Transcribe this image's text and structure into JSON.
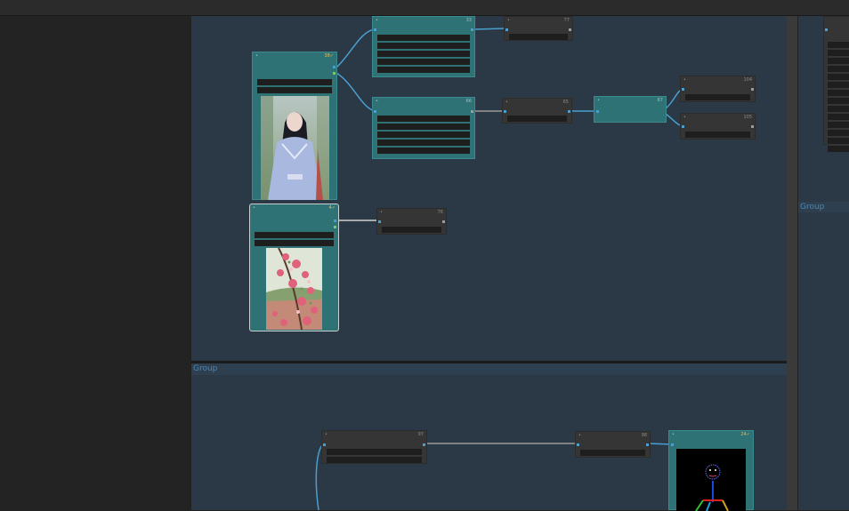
{
  "groups": {
    "lower_title": "Group",
    "right_title": "Group"
  },
  "nodes": {
    "n33": {
      "id": "33"
    },
    "n77": {
      "id": "77"
    },
    "n66": {
      "id": "66"
    },
    "n65": {
      "id": "65"
    },
    "n67": {
      "id": "67"
    },
    "n104": {
      "id": "104"
    },
    "n105": {
      "id": "105"
    },
    "n_load_person": {
      "id": "38",
      "badge": "✓"
    },
    "n_load_flowers": {
      "id": "4",
      "badge": "✓"
    },
    "n76": {
      "id": "76"
    },
    "n97": {
      "id": "97"
    },
    "n98": {
      "id": "98"
    },
    "n_pose": {
      "id": "24",
      "badge": "✓"
    }
  },
  "colors": {
    "canvas": "#2b3845",
    "node_teal": "#2f7276",
    "node_dark": "#353535",
    "wire_blue": "#4a9fd0",
    "wire_gray": "#9a9a9a"
  }
}
